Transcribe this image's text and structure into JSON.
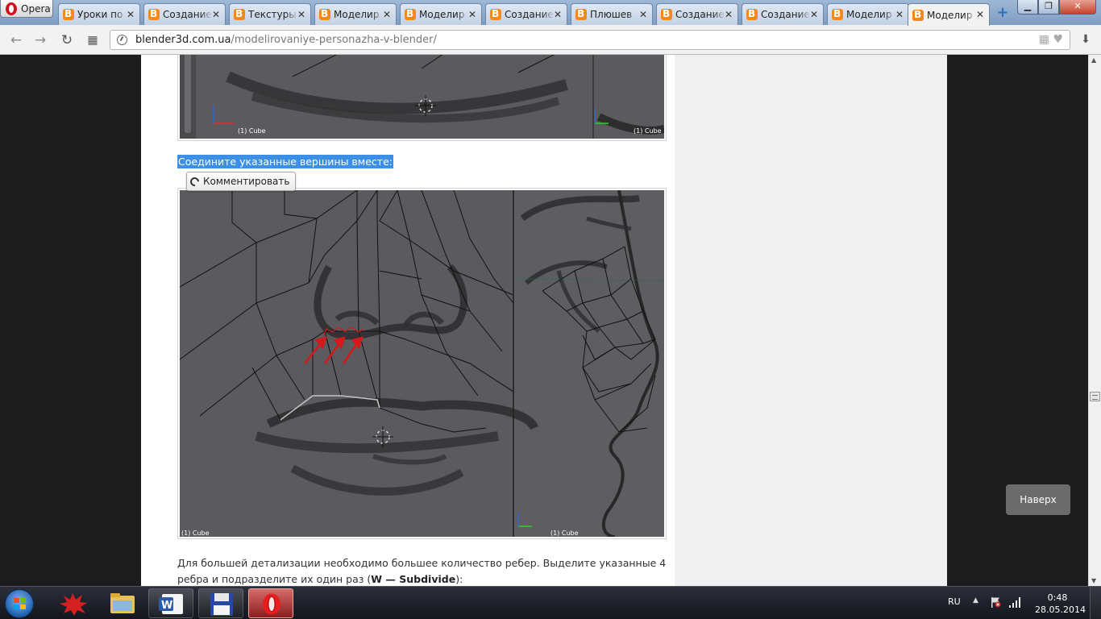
{
  "browser": {
    "menu_label": "Opera",
    "tabs": [
      {
        "title": "Уроки по"
      },
      {
        "title": "Создание"
      },
      {
        "title": "Текстуры"
      },
      {
        "title": "Моделир"
      },
      {
        "title": "Моделир"
      },
      {
        "title": "Создание"
      },
      {
        "title": "Плюшев"
      },
      {
        "title": "Создание"
      },
      {
        "title": "Создание"
      },
      {
        "title": "Моделир"
      },
      {
        "title": "Моделир"
      }
    ],
    "active_tab_index": 10,
    "new_tab_symbol": "+",
    "url_host": "blender3d.com.ua",
    "url_path": "/modelirovaniye-personazha-v-blender/"
  },
  "article": {
    "selected_sentence": "Соедините указанные вершины вместе:",
    "comment_button_label": "Комментировать",
    "image_top": {
      "label_left": "(1) Cube",
      "label_right": "(1) Cube"
    },
    "image_main": {
      "label_left": "(1) Cube",
      "label_right": "(1) Cube"
    },
    "paragraph_text": "Для большей детализации необходимо большее количество ребер. Выделите указанные 4 ребра и подразделите их один раз (",
    "paragraph_shortcut": "W — Subdivide",
    "paragraph_end": "):"
  },
  "page": {
    "back_to_top_label": "Наверх"
  },
  "taskbar": {
    "language": "RU",
    "time": "0:48",
    "date": "28.05.2014"
  },
  "colors": {
    "selection": "#3c8fe4",
    "annotation_red": "#d21a1a",
    "viewport_gray": "#5b5b5f"
  }
}
